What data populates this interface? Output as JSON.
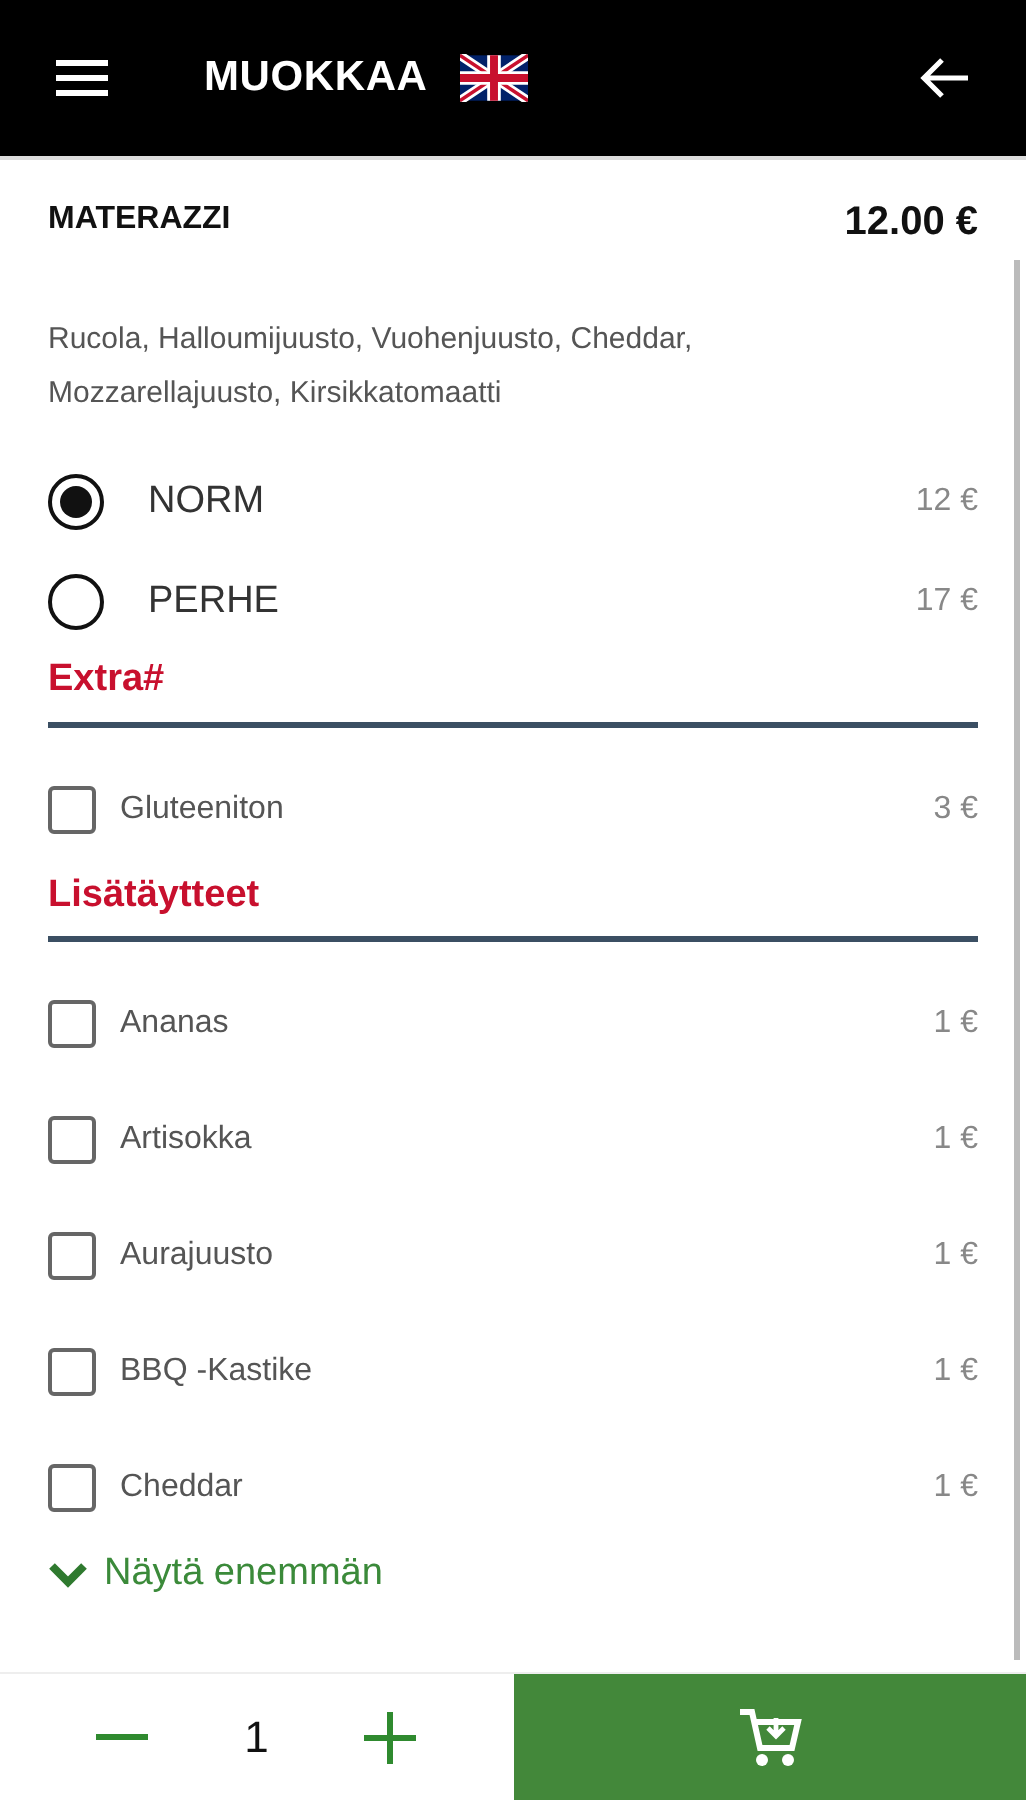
{
  "header": {
    "title": "MUOKKAA"
  },
  "product": {
    "name": "MATERAZZI",
    "price": "12.00 €",
    "description": "Rucola, Halloumijuusto, Vuohenjuusto, Cheddar, Mozzarellajuusto, Kirsikkatomaatti"
  },
  "sizes": [
    {
      "label": "NORM",
      "price": "12 €",
      "selected": true
    },
    {
      "label": "PERHE",
      "price": "17 €",
      "selected": false
    }
  ],
  "groups": [
    {
      "title": "Extra#",
      "options": [
        {
          "label": "Gluteeniton",
          "price": "3 €",
          "checked": false
        }
      ]
    },
    {
      "title": "Lisätäytteet",
      "options": [
        {
          "label": "Ananas",
          "price": "1 €",
          "checked": false
        },
        {
          "label": "Artisokka",
          "price": "1 €",
          "checked": false
        },
        {
          "label": "Aurajuusto",
          "price": "1 €",
          "checked": false
        },
        {
          "label": "BBQ -Kastike",
          "price": "1 €",
          "checked": false
        },
        {
          "label": "Cheddar",
          "price": "1 €",
          "checked": false
        }
      ]
    }
  ],
  "more_link": "Näytä enemmän",
  "quantity": "1"
}
